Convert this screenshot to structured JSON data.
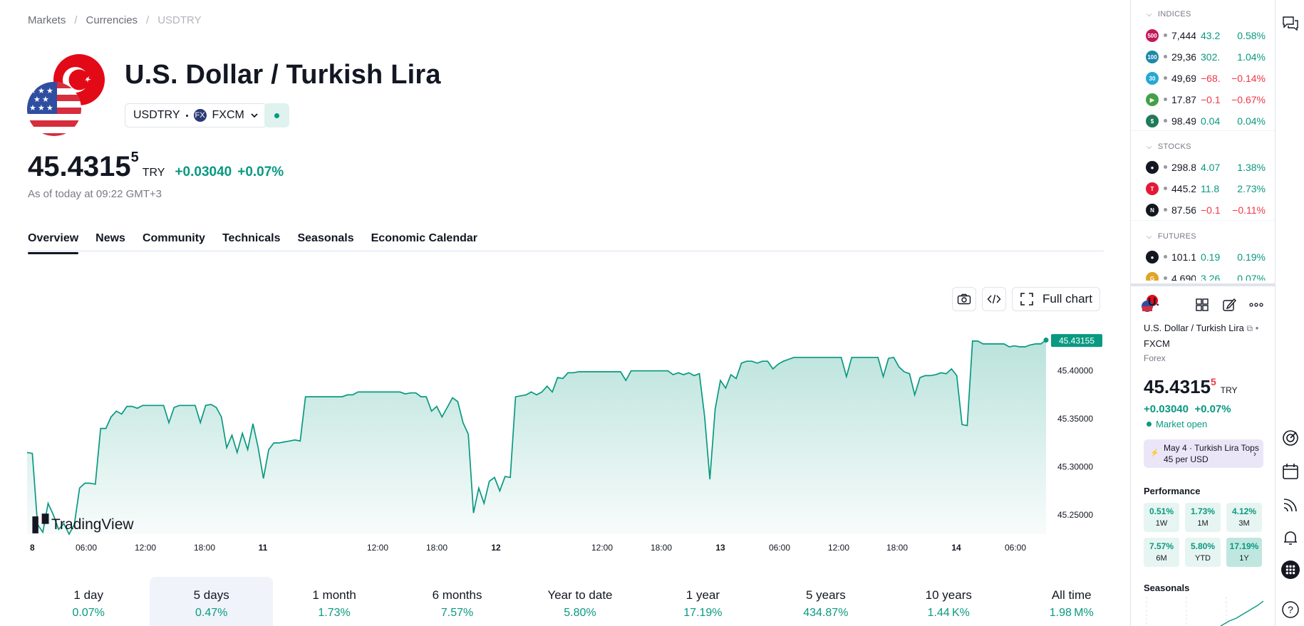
{
  "breadcrumb": {
    "items": [
      "Markets",
      "Currencies"
    ],
    "current": "USDTRY"
  },
  "header": {
    "title": "U.S. Dollar / Turkish Lira",
    "symbol": "USDTRY",
    "exchange": "FXCM",
    "exchange_badge": "FX"
  },
  "quote": {
    "price": "45.4315",
    "price_sup": "5",
    "currency": "TRY",
    "change": "+0.03040",
    "change_pct": "+0.07%",
    "as_of": "As of today at 09:22 GMT+3"
  },
  "tabs": [
    "Overview",
    "News",
    "Community",
    "Technicals",
    "Seasonals",
    "Economic Calendar"
  ],
  "chart_tools": {
    "snapshot_icon": "camera-icon",
    "embed_icon": "code-icon",
    "full_chart_label": "Full chart"
  },
  "chart_data": {
    "type": "area",
    "title": "",
    "color": "#089981",
    "y_ticks": [
      "45.40000",
      "45.35000",
      "45.30000",
      "45.25000"
    ],
    "y_range": [
      45.23,
      45.445
    ],
    "last_label": "45.43155",
    "last_value": 45.43155,
    "x_ticks": [
      "8",
      "06:00",
      "12:00",
      "18:00",
      "11",
      "12:00",
      "18:00",
      "12",
      "12:00",
      "18:00",
      "13",
      "06:00",
      "12:00",
      "18:00",
      "14",
      "06:00"
    ],
    "x_ticks_bold": [
      true,
      false,
      false,
      false,
      true,
      false,
      false,
      true,
      false,
      false,
      true,
      false,
      false,
      false,
      true,
      false
    ],
    "watermark": "TradingView",
    "values": [
      45.315,
      45.314,
      45.24,
      45.232,
      45.262,
      45.25,
      45.235,
      45.241,
      45.23,
      45.24,
      45.278,
      45.283,
      45.283,
      45.282,
      45.34,
      45.34,
      45.352,
      45.358,
      45.355,
      45.363,
      45.363,
      45.361,
      45.364,
      45.364,
      45.364,
      45.364,
      45.364,
      45.346,
      45.362,
      45.364,
      45.364,
      45.364,
      45.364,
      45.346,
      45.364,
      45.365,
      45.362,
      45.352,
      45.32,
      45.333,
      45.315,
      45.335,
      45.318,
      45.345,
      45.32,
      45.288,
      45.318,
      45.325,
      45.325,
      45.326,
      45.327,
      45.328,
      45.327,
      45.373,
      45.373,
      45.373,
      45.373,
      45.373,
      45.373,
      45.373,
      45.373,
      45.375,
      45.375,
      45.378,
      45.378,
      45.378,
      45.378,
      45.378,
      45.378,
      45.378,
      45.378,
      45.378,
      45.376,
      45.377,
      45.377,
      45.373,
      45.373,
      45.358,
      45.363,
      45.352,
      45.362,
      45.372,
      45.368,
      45.346,
      45.334,
      45.252,
      45.278,
      45.262,
      45.285,
      45.289,
      45.275,
      45.29,
      45.289,
      45.373,
      45.374,
      45.375,
      45.378,
      45.375,
      45.378,
      45.384,
      45.378,
      45.393,
      45.392,
      45.398,
      45.398,
      45.399,
      45.399,
      45.399,
      45.399,
      45.399,
      45.399,
      45.399,
      45.399,
      45.399,
      45.39,
      45.4,
      45.4,
      45.4,
      45.4,
      45.4,
      45.4,
      45.4,
      45.4,
      45.396,
      45.398,
      45.396,
      45.398,
      45.395,
      45.397,
      45.352,
      45.287,
      45.36,
      45.39,
      45.382,
      45.396,
      45.392,
      45.408,
      45.41,
      45.41,
      45.408,
      45.41,
      45.41,
      45.402,
      45.407,
      45.41,
      45.412,
      45.414,
      45.414,
      45.414,
      45.414,
      45.414,
      45.414,
      45.414,
      45.414,
      45.414,
      45.414,
      45.394,
      45.414,
      45.414,
      45.414,
      45.414,
      45.414,
      45.414,
      45.394,
      45.413,
      45.414,
      45.404,
      45.399,
      45.397,
      45.375,
      45.393,
      45.395,
      45.395,
      45.396,
      45.398,
      45.397,
      45.402,
      45.395,
      45.344,
      45.343,
      45.431,
      45.431,
      45.428,
      45.428,
      45.428,
      45.428,
      45.428,
      45.425,
      45.426,
      45.425,
      45.425,
      45.427,
      45.428,
      45.428,
      45.432
    ]
  },
  "ranges": [
    {
      "label": "1 day",
      "value": "0.07%",
      "active": false
    },
    {
      "label": "5 days",
      "value": "0.47%",
      "active": true
    },
    {
      "label": "1 month",
      "value": "1.73%",
      "active": false
    },
    {
      "label": "6 months",
      "value": "7.57%",
      "active": false
    },
    {
      "label": "Year to date",
      "value": "5.80%",
      "active": false
    },
    {
      "label": "1 year",
      "value": "17.19%",
      "active": false
    },
    {
      "label": "5 years",
      "value": "434.87%",
      "active": false
    },
    {
      "label": "10 years",
      "value": "1.44 K%",
      "active": false
    },
    {
      "label": "All time",
      "value": "1.98 M%",
      "active": false
    }
  ],
  "watchlist": {
    "indices_label": "INDICES",
    "stocks_label": "STOCKS",
    "futures_label": "FUTURES",
    "indices": [
      {
        "logo": "500",
        "color": "#c2185b",
        "last": "7,444",
        "chg": "43.2",
        "chp": "0.58%",
        "dir": "up"
      },
      {
        "logo": "100",
        "color": "#1e88a8",
        "last": "29,36",
        "chg": "302.",
        "chp": "1.04%",
        "dir": "up"
      },
      {
        "logo": "30",
        "color": "#26a9d2",
        "last": "49,69",
        "chg": "−68.",
        "chp": "−0.14%",
        "dir": "down"
      },
      {
        "logo": "▶",
        "color": "#43a047",
        "last": "17.87",
        "chg": "−0.1",
        "chp": "−0.67%",
        "dir": "down"
      },
      {
        "logo": "$",
        "color": "#1f7a5a",
        "last": "98.49",
        "chg": "0.04",
        "chp": "0.04%",
        "dir": "up"
      }
    ],
    "stocks": [
      {
        "logo": "●",
        "color": "#131722",
        "last": "298.8",
        "chg": "4.07",
        "chp": "1.38%",
        "dir": "up"
      },
      {
        "logo": "T",
        "color": "#e31937",
        "last": "445.2",
        "chg": "11.8",
        "chp": "2.73%",
        "dir": "up"
      },
      {
        "logo": "N",
        "color": "#131722",
        "last": "87.56",
        "chg": "−0.1",
        "chp": "−0.11%",
        "dir": "down"
      }
    ],
    "futures": [
      {
        "logo": "●",
        "color": "#131722",
        "last": "101.1",
        "chg": "0.19",
        "chp": "0.19%",
        "dir": "up"
      },
      {
        "logo": "G",
        "color": "#e0a526",
        "last": "4.690",
        "chg": "3.26",
        "chp": "0.07%",
        "dir": "up"
      }
    ]
  },
  "details": {
    "short_symbol": "U.",
    "name": "U.S. Dollar / Turkish Lira",
    "exchange": "FXCM",
    "type": "Forex",
    "price": "45.4315",
    "price_sup": "5",
    "currency": "TRY",
    "change": "+0.03040  +0.07%",
    "market_status": "Market open",
    "news_date": "May 4",
    "news_text": "Turkish Lira Tops 45 per USD",
    "performance_title": "Performance",
    "performance": [
      {
        "value": "0.51%",
        "label": "1W",
        "strong": false
      },
      {
        "value": "1.73%",
        "label": "1M",
        "strong": false
      },
      {
        "value": "4.12%",
        "label": "3M",
        "strong": false
      },
      {
        "value": "7.57%",
        "label": "6M",
        "strong": false
      },
      {
        "value": "5.80%",
        "label": "YTD",
        "strong": false
      },
      {
        "value": "17.19%",
        "label": "1Y",
        "strong": true
      }
    ],
    "seasonals_title": "Seasonals"
  },
  "toolbar_icons": [
    "chat-icon",
    "target-icon",
    "calendar-icon",
    "broadcast-icon",
    "bell-icon",
    "apps-icon",
    "help-icon"
  ]
}
